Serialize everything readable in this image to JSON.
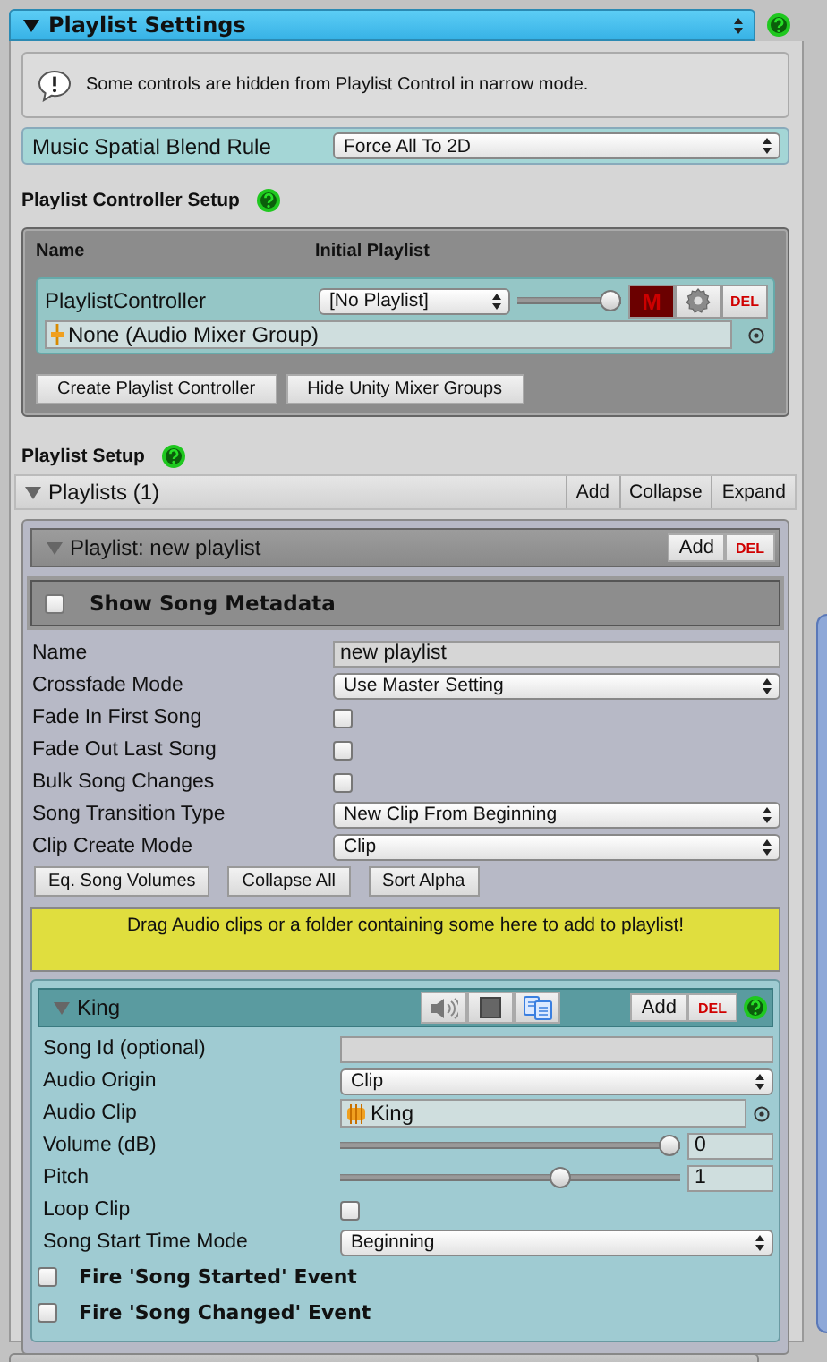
{
  "header": {
    "title": "Playlist Settings",
    "expanded": true
  },
  "notice": "Some controls are hidden from Playlist Control in narrow mode.",
  "spatial_blend": {
    "label": "Music Spatial Blend Rule",
    "value": "Force All To 2D"
  },
  "controller_setup": {
    "title": "Playlist Controller Setup",
    "columns": [
      "Name",
      "Initial Playlist"
    ],
    "controllers": [
      {
        "name": "PlaylistController",
        "playlist": "[No Playlist]",
        "level": 1,
        "mute": "M",
        "delete": "DEL",
        "mixer_group": "None (Audio Mixer Group)"
      }
    ],
    "buttons": [
      "Create Playlist Controller",
      "Hide Unity Mixer Groups"
    ]
  },
  "playlist_setup": {
    "title": "Playlist Setup",
    "list_title": "Playlists (1)",
    "expanded": true,
    "buttons": [
      "Add",
      "Collapse",
      "Expand"
    ],
    "playlists": [
      {
        "title": "Playlist: new playlist",
        "expanded": true,
        "add": "Add",
        "delete": "DEL",
        "metadata": {
          "label": "Show Song Metadata",
          "checked": false
        },
        "fields": [
          {
            "kind": "text",
            "label": "Name",
            "value": "new playlist"
          },
          {
            "kind": "select",
            "label": "Crossfade Mode",
            "value": "Use Master Setting"
          },
          {
            "kind": "checkbox",
            "label": "Fade In First Song",
            "checked": false
          },
          {
            "kind": "checkbox",
            "label": "Fade Out Last Song",
            "checked": false
          },
          {
            "kind": "checkbox",
            "label": "Bulk Song Changes",
            "checked": false
          },
          {
            "kind": "select",
            "label": "Song Transition Type",
            "value": "New Clip From Beginning"
          },
          {
            "kind": "select",
            "label": "Clip Create Mode",
            "value": "Clip"
          }
        ],
        "buttons": [
          "Eq. Song Volumes",
          "Collapse All",
          "Sort Alpha"
        ],
        "drop_hint": "Drag Audio clips or a folder containing some here to add to playlist!",
        "songs": [
          {
            "title": "King",
            "expanded": true,
            "add": "Add",
            "delete": "DEL",
            "fields": [
              {
                "kind": "text",
                "label": "Song Id (optional)"
              },
              {
                "kind": "select",
                "label": "Audio Origin",
                "value": "Clip"
              },
              {
                "kind": "object",
                "label": "Audio Clip",
                "value": "King"
              },
              {
                "kind": "slider",
                "label": "Volume (dB)",
                "level": 1,
                "value": "0"
              },
              {
                "kind": "slider",
                "label": "Pitch",
                "level": 0.66,
                "value": "1"
              },
              {
                "kind": "checkbox",
                "label": "Loop Clip",
                "checked": false
              },
              {
                "kind": "select",
                "label": "Song Start Time Mode",
                "value": "Beginning"
              }
            ],
            "events": [
              {
                "label": "Fire 'Song Started' Event",
                "checked": false
              },
              {
                "label": "Fire 'Song Changed' Event",
                "checked": false
              }
            ]
          }
        ]
      }
    ]
  }
}
